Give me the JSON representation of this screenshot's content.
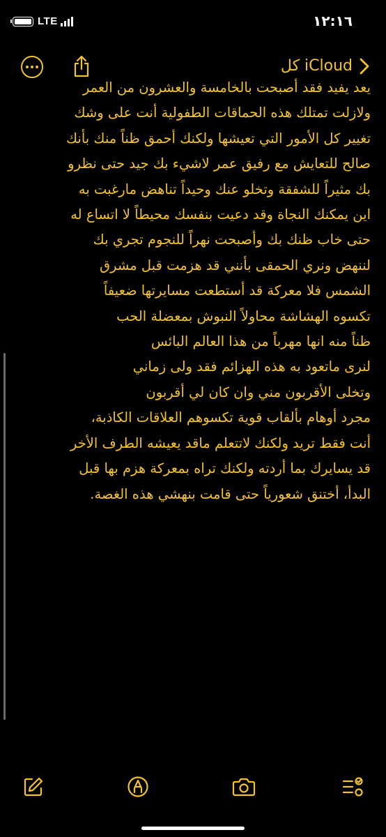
{
  "status_bar": {
    "time": "١٢:١٦",
    "network": "LTE",
    "battery_level": 0.85
  },
  "nav": {
    "back_label": "كل iCloud",
    "icons": [
      "chevron-right-icon",
      "share-icon",
      "more-ellipsis-icon"
    ]
  },
  "note": {
    "lines": [
      "يعد يفيد فقد أصبحت بالخامسة والعشرون من العمر",
      "ولازلت تمتلك هذه الحماقات الطفولية أنت على وشك",
      "تغيير كل الأمور التي تعيشها ولكنك أحمق ظناً منك بأنك",
      "صالح للتعايش مع رفيق عمر لاشيء بك جيد حتى نظرو",
      "بك مثيراً للشفقة وتخلو عنك وحيداً تناهض مارغبت به",
      "اين يمكنك النجاة وقد دعيت بنفسك محيطاً لا اتساع له",
      "حتى خاب ظنك بك وأصبحت نهراً للنجوم تجري بك",
      "لننهض ونري الحمقى بأنني قد هزمت قبل مشرق",
      "الشمس فلا معركة قد أستطعت مسايرتها ضعيفاً",
      "تكسوه الهشاشة محاولاً النبوش بمعضلة الحب",
      "ظناً منه انها مهرباً من هذا العالم البائس",
      "لنرى ماتعود به هذه الهزائم فقد ولى زماني",
      "وتخلى الأقربون مني وان كان لي أقربون",
      "مجرد أوهام بألقاب قوية تكسوهم العلاقات الكاذبة،",
      "أنت فقط تريد ولكنك لاتتعلم ماقد يعيشه الطرف الأخر",
      "قد يسايرك بما أردته ولكنك تراه بمعركة هزم بها قبل",
      "البدأ، أختنق شعورياً حتى قامت بنهشي هذه الغصة."
    ]
  },
  "toolbar": {
    "icons": [
      "compose-icon",
      "markup-icon",
      "camera-icon",
      "checklist-icon"
    ]
  },
  "colors": {
    "accent": "#f2c230",
    "background": "#000000"
  }
}
